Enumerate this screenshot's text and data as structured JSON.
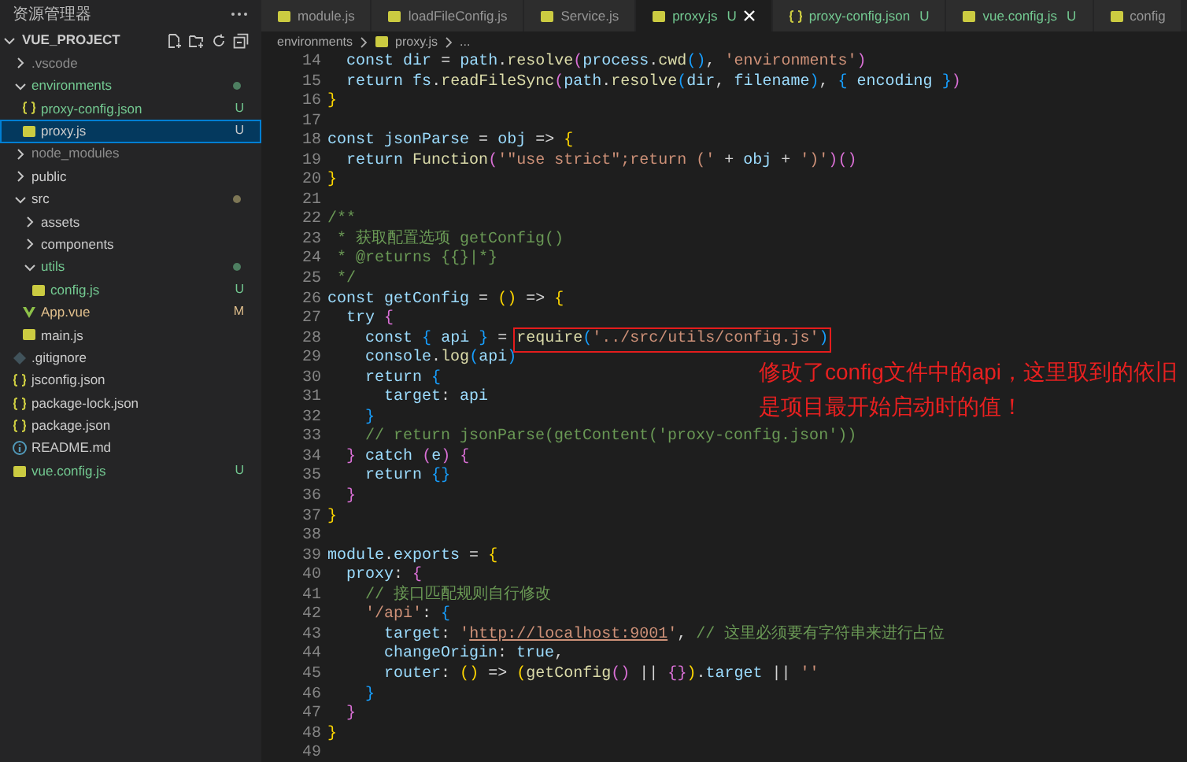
{
  "sidebar": {
    "title": "资源管理器",
    "project": {
      "label": "VUE_PROJECT",
      "expanded": true
    },
    "tree": [
      {
        "label": ".vscode",
        "kind": "folder",
        "expanded": false,
        "selected": false,
        "dimmed": true
      },
      {
        "label": "environments",
        "kind": "folder",
        "expanded": true,
        "selected": false,
        "color": "#73c991",
        "marker": {
          "color": "#4e7f61"
        },
        "children": [
          {
            "label": "proxy-config.json",
            "kind": "json",
            "selected": false,
            "color": "#73c991",
            "badge": "U"
          },
          {
            "label": "proxy.js",
            "kind": "js",
            "selected": true,
            "badge": "U"
          }
        ]
      },
      {
        "label": "node_modules",
        "kind": "folder",
        "expanded": false,
        "selected": false,
        "dimmed": true
      },
      {
        "label": "public",
        "kind": "folder",
        "expanded": false,
        "selected": false
      },
      {
        "label": "src",
        "kind": "folder",
        "expanded": true,
        "selected": false,
        "marker": {
          "color": "#7d7655"
        },
        "children": [
          {
            "label": "assets",
            "kind": "folder",
            "expanded": false,
            "selected": false
          },
          {
            "label": "components",
            "kind": "folder",
            "expanded": false,
            "selected": false
          },
          {
            "label": "utils",
            "kind": "folder",
            "expanded": true,
            "selected": false,
            "color": "#73c991",
            "marker": {
              "color": "#4e7f61"
            },
            "children": [
              {
                "label": "config.js",
                "kind": "js",
                "selected": false,
                "color": "#73c991",
                "badge": "U"
              }
            ]
          },
          {
            "label": "App.vue",
            "kind": "vue",
            "selected": false,
            "color": "#e2c08d",
            "badge": "M"
          },
          {
            "label": "main.js",
            "kind": "js",
            "selected": false
          }
        ]
      },
      {
        "label": ".gitignore",
        "kind": "git",
        "selected": false
      },
      {
        "label": "jsconfig.json",
        "kind": "json",
        "selected": false
      },
      {
        "label": "package-lock.json",
        "kind": "json",
        "selected": false
      },
      {
        "label": "package.json",
        "kind": "json",
        "selected": false
      },
      {
        "label": "README.md",
        "kind": "info",
        "selected": false
      },
      {
        "label": "vue.config.js",
        "kind": "js",
        "selected": false,
        "color": "#73c991",
        "badge": "U"
      }
    ]
  },
  "tabs": [
    {
      "kind": "js",
      "label": "module.js",
      "selected": false
    },
    {
      "kind": "js",
      "label": "loadFileConfig.js",
      "selected": false
    },
    {
      "kind": "js",
      "label": "Service.js",
      "selected": false
    },
    {
      "kind": "js",
      "label": "proxy.js",
      "badge": "U",
      "selected": true
    },
    {
      "kind": "json",
      "label": "proxy-config.json",
      "badge": "U",
      "selected": false
    },
    {
      "kind": "js",
      "label": "vue.config.js",
      "badge": "U",
      "selected": false
    },
    {
      "kind": "js",
      "label": "config",
      "selected": false
    }
  ],
  "breadcrumb": [
    {
      "kind": "folder",
      "label": "environments"
    },
    {
      "kind": "js",
      "label": "proxy.js"
    },
    {
      "kind": "more",
      "label": "..."
    }
  ],
  "code": [
    {
      "n": "14",
      "text": "  const dir = path.resolve(process.cwd(), 'environments')"
    },
    {
      "n": "15",
      "text": "  return fs.readFileSync(path.resolve(dir, filename), { encoding })"
    },
    {
      "n": "16",
      "text": "}"
    },
    {
      "n": "17"
    },
    {
      "n": "18",
      "text": "const jsonParse = obj => {"
    },
    {
      "n": "19",
      "text": "  return Function('\"use strict\";return (' + obj + ')')()"
    },
    {
      "n": "20",
      "text": "}"
    },
    {
      "n": "21"
    },
    {
      "n": "22",
      "text": "/**",
      "kind": "comment"
    },
    {
      "n": "23",
      "text": " * 获取配置选项 getConfig()",
      "kind": "comment"
    },
    {
      "n": "24",
      "text": " * @returns {{}|*}",
      "kind": "comment"
    },
    {
      "n": "25",
      "text": " */",
      "kind": "comment"
    },
    {
      "n": "26",
      "text": "const getConfig = () => {"
    },
    {
      "n": "27",
      "text": "  try {"
    },
    {
      "n": "28",
      "text": "    const { api } = ",
      "boxed": "require('../src/utils/config.js')"
    },
    {
      "n": "29",
      "text": "    console.log(api)"
    },
    {
      "n": "30",
      "text": "    return {"
    },
    {
      "n": "31",
      "text": "      target: api"
    },
    {
      "n": "32",
      "text": "    }"
    },
    {
      "n": "33",
      "text": "    // return jsonParse(getContent('proxy-config.json'))"
    },
    {
      "n": "34",
      "text": "  } catch (e) {"
    },
    {
      "n": "35",
      "text": "    return {}"
    },
    {
      "n": "36",
      "text": "  }"
    },
    {
      "n": "37",
      "text": "}"
    },
    {
      "n": "38"
    },
    {
      "n": "39",
      "text": "module.exports = {"
    },
    {
      "n": "40",
      "text": "  proxy: {"
    },
    {
      "n": "41",
      "text": "    // 接口匹配规则自行修改"
    },
    {
      "n": "42",
      "text": "    '/api': {"
    },
    {
      "n": "43",
      "text": "      target: 'http://localhost:9001', // 这里必须要有字符串来进行占位"
    },
    {
      "n": "44",
      "text": "      changeOrigin: true,"
    },
    {
      "n": "45",
      "text": "      router: () => (getConfig() || {}).target || ''"
    },
    {
      "n": "46",
      "text": "    }"
    },
    {
      "n": "47",
      "text": "  }"
    },
    {
      "n": "48",
      "text": "}"
    },
    {
      "n": "49"
    }
  ],
  "annotation": {
    "text": "修改了config文件中的api，这里取到的依旧是项目最开始启动时的值！"
  }
}
